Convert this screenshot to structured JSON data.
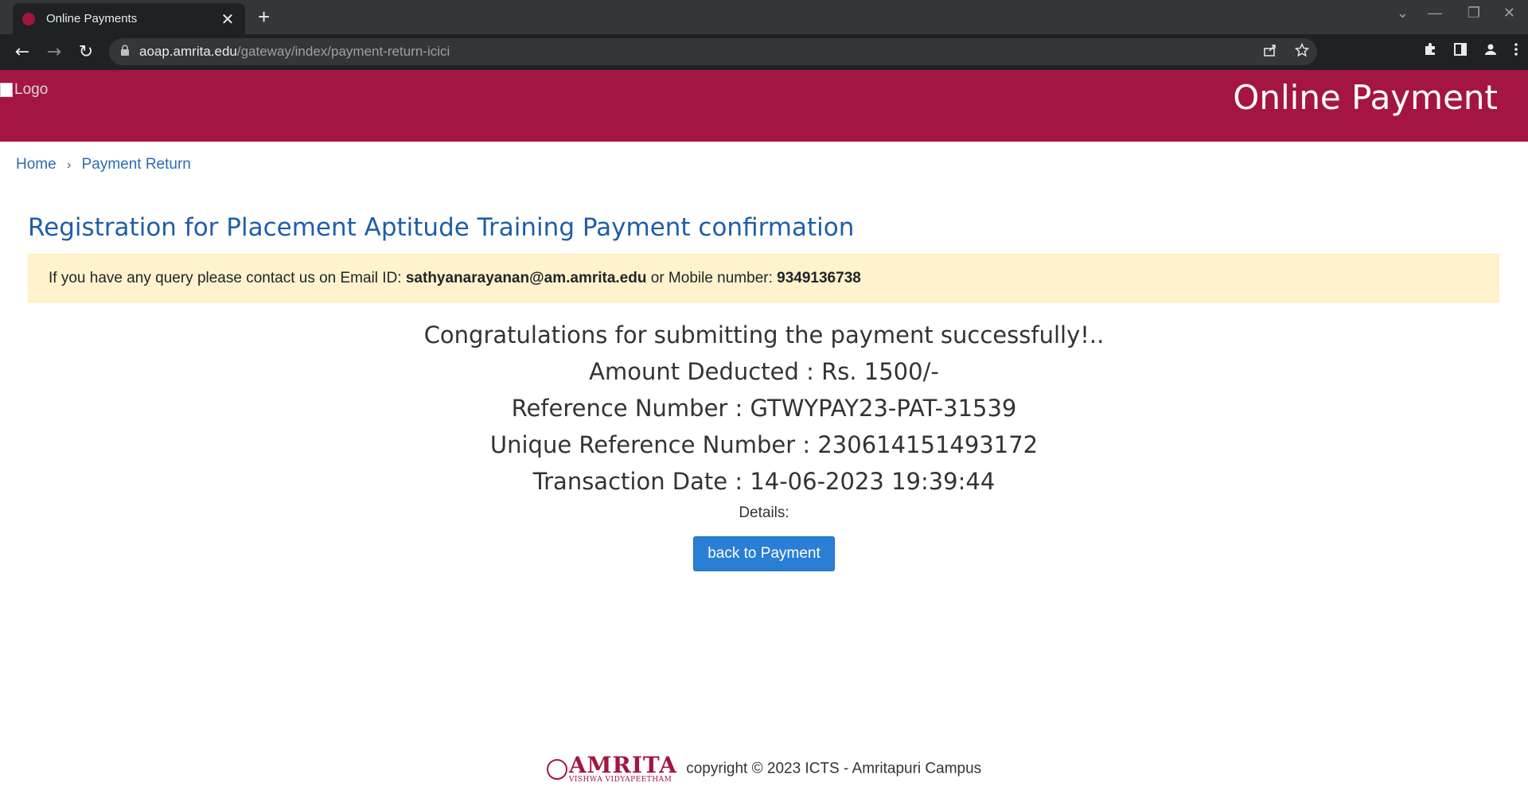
{
  "browser": {
    "tab_title": "Online Payments",
    "tab_close": "✕",
    "new_tab": "+",
    "window_controls": [
      "⌄",
      "—",
      "❐",
      "✕"
    ],
    "back": "←",
    "forward": "→",
    "reload": "↻",
    "url_host": "aoap.amrita.edu",
    "url_path": "/gateway/index/payment-return-icici",
    "omnibox_icons": [
      "share-icon",
      "star-icon"
    ],
    "extension_icons": [
      "puzzle-icon",
      "sidepanel-icon",
      "profile-icon",
      "menu-icon"
    ]
  },
  "header": {
    "logo_alt": "Logo",
    "title": "Online Payment",
    "background": "#a51541"
  },
  "breadcrumb": {
    "home": "Home",
    "separator": "›",
    "current": "Payment Return"
  },
  "page": {
    "title": "Registration for Placement Aptitude Training Payment confirmation",
    "alert_prefix": "If you have any query please contact us on Email ID: ",
    "alert_email": "sathyanarayanan@am.amrita.edu",
    "alert_middle": " or Mobile number: ",
    "alert_mobile": "9349136738"
  },
  "result": {
    "congrats": "Congratulations for submitting the payment successfully!..",
    "amount": "Amount Deducted : Rs. 1500/-",
    "reference": "Reference Number : GTWYPAY23-PAT-31539",
    "unique_reference": "Unique Reference Number : 230614151493172",
    "transaction_date": "Transaction Date : 14-06-2023 19:39:44",
    "details_label": "Details:",
    "back_button": "back to Payment"
  },
  "footer": {
    "logo_word": "AMRITA",
    "logo_sub": "VISHWA VIDYAPEETHAM",
    "copyright": "copyright © 2023 ICTS - Amritapuri Campus"
  }
}
